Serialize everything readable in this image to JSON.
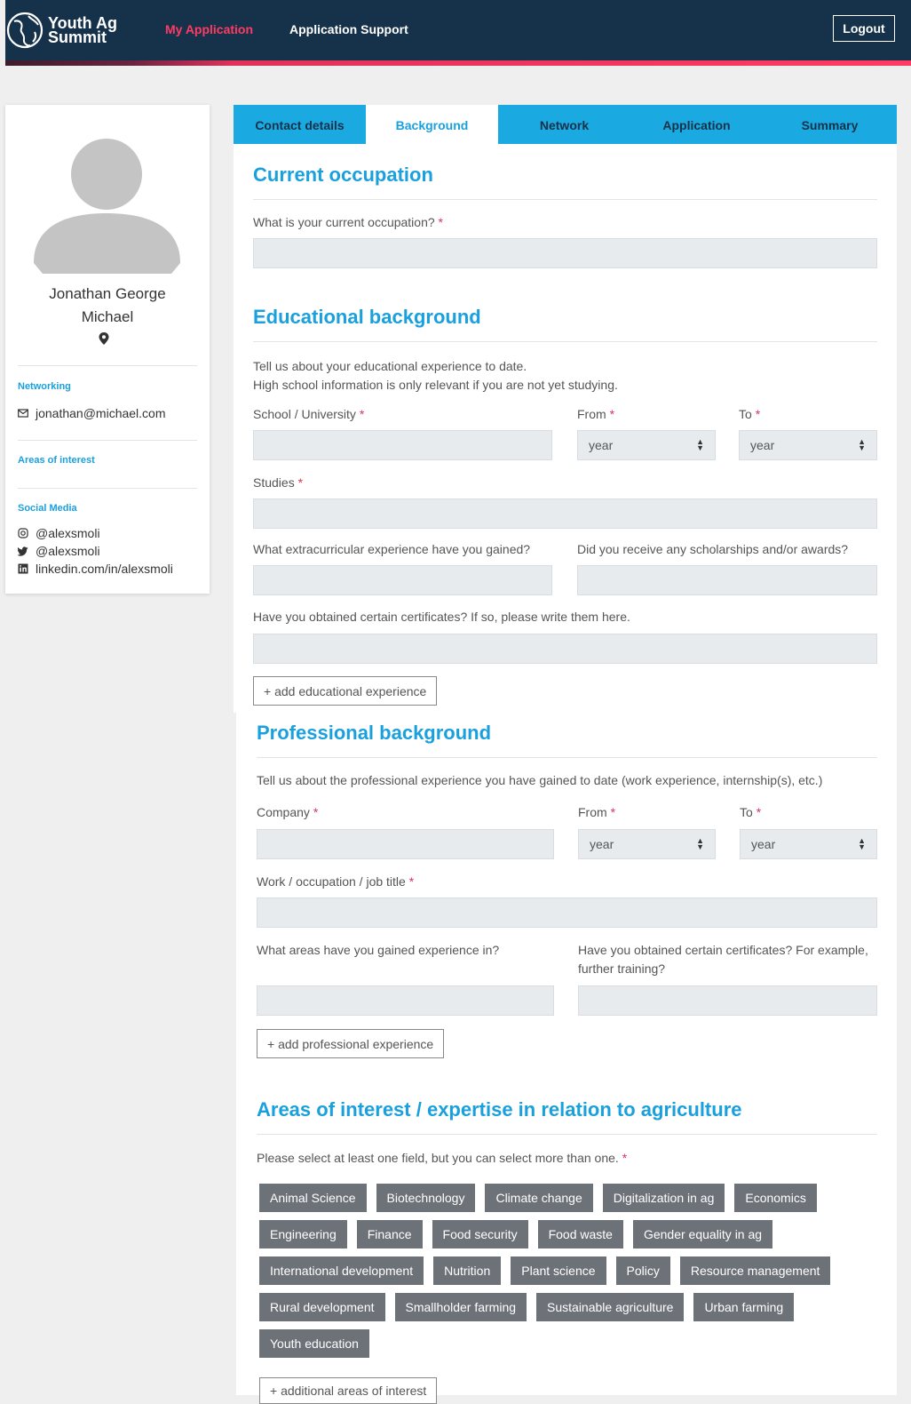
{
  "header": {
    "logo_line1": "Youth Ag",
    "logo_line2": "Summit",
    "nav_my_application": "My Application",
    "nav_application_support": "Application Support",
    "logout_label": "Logout"
  },
  "sidebar": {
    "name_line1": "Jonathan George",
    "name_line2": "Michael",
    "networking_heading": "Networking",
    "email": "jonathan@michael.com",
    "areas_heading": "Areas of interest",
    "social_heading": "Social Media",
    "instagram": "@alexsmoli",
    "twitter": "@alexsmoli",
    "linkedin": "linkedin.com/in/alexsmoli"
  },
  "tabs": [
    "Contact details",
    "Background",
    "Network",
    "Application",
    "Summary"
  ],
  "current_occupation": {
    "title": "Current occupation",
    "question": "What is your current occupation?"
  },
  "education": {
    "title": "Educational background",
    "intro_line1": "Tell us about your educational experience to date.",
    "intro_line2": "High school information is only relevant if you are not yet studying.",
    "school_label": "School / University",
    "from_label": "From",
    "to_label": "To",
    "from_value": "year",
    "to_value": "year",
    "studies_label": "Studies",
    "extracurricular_label": "What extracurricular experience have you gained?",
    "scholarships_label": "Did you receive any scholarships and/or awards?",
    "certificates_label": "Have you obtained certain certificates? If so, please write them here.",
    "add_button": "+ add educational experience"
  },
  "professional": {
    "title": "Professional background",
    "intro": "Tell us about the professional experience you have gained to date (work experience, internship(s), etc.)",
    "company_label": "Company",
    "from_label": "From",
    "to_label": "To",
    "from_value": "year",
    "to_value": "year",
    "job_label": "Work / occupation / job title",
    "areas_label": "What areas have you gained experience in?",
    "certificates_line1": "Have you obtained certain certificates? For example,",
    "certificates_line2": "further training?",
    "add_button": "+ add professional experience"
  },
  "interests": {
    "title": "Areas of interest / expertise in relation to agriculture",
    "instruction": "Please select at least one field, but you can select more than one.",
    "rows": [
      [
        "Animal Science",
        "Biotechnology",
        "Climate change",
        "Digitalization in ag",
        "Economics"
      ],
      [
        "Engineering",
        "Finance",
        "Food security",
        "Food waste",
        "Gender equality in ag"
      ],
      [
        "International development",
        "Nutrition",
        "Plant science",
        "Policy",
        "Resource management"
      ],
      [
        "Rural development",
        "Smallholder farming",
        "Sustainable agriculture",
        "Urban farming"
      ],
      [
        "Youth education"
      ]
    ],
    "add_button": "+ additional areas of interest"
  },
  "colors": {
    "navy": "#16324a",
    "accent_pink": "#ff3b63",
    "accent_blue": "#1aa9e0",
    "tag_gray": "#6d7178"
  },
  "icons": [
    "globe-logo-icon",
    "avatar-placeholder-icon",
    "map-pin-icon",
    "envelope-icon",
    "instagram-icon",
    "twitter-icon",
    "linkedin-icon",
    "select-arrows-icon"
  ]
}
